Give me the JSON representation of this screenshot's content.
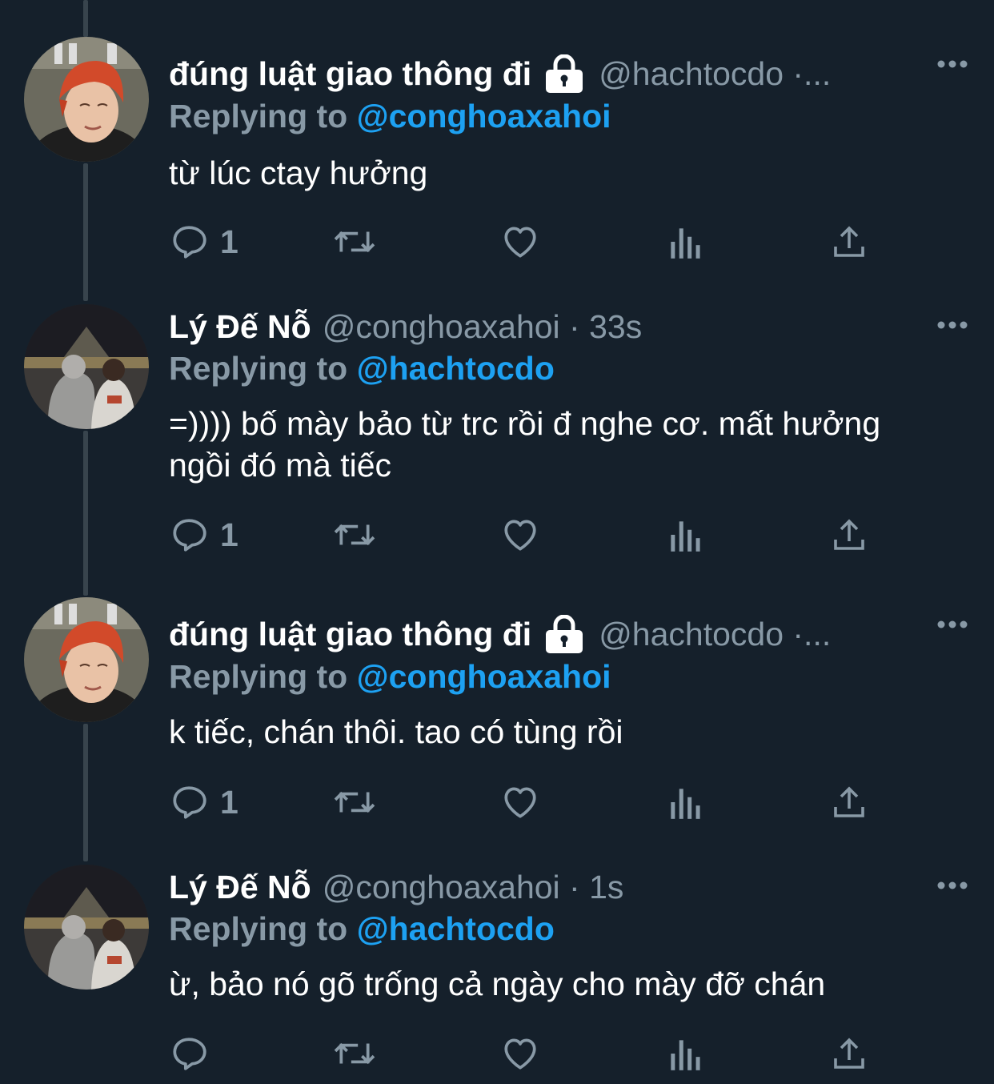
{
  "tweets": [
    {
      "author": "đúng luật giao thông đi",
      "locked": true,
      "handle_meta": "@hachtocdo ·...",
      "reply_prefix": "Replying to",
      "reply_to": "@conghoaxahoi",
      "text": "từ lúc ctay hưởng",
      "reply_count": "1",
      "avatar": "red-hair-person-avatar"
    },
    {
      "author": "Lý Đế Nỗ",
      "locked": false,
      "handle_meta": "@conghoaxahoi · 33s",
      "reply_prefix": "Replying to",
      "reply_to": "@hachtocdo",
      "text": "=)))) bố mày bảo từ trc rồi đ nghe cơ. mất hưởng ngồi đó mà tiếc",
      "reply_count": "1",
      "avatar": "two-people-louvre-avatar"
    },
    {
      "author": "đúng luật giao thông đi",
      "locked": true,
      "handle_meta": "@hachtocdo ·...",
      "reply_prefix": "Replying to",
      "reply_to": "@conghoaxahoi",
      "text": "k tiếc, chán thôi. tao có tùng rồi",
      "reply_count": "1",
      "avatar": "red-hair-person-avatar"
    },
    {
      "author": "Lý Đế Nỗ",
      "locked": false,
      "handle_meta": "@conghoaxahoi · 1s",
      "reply_prefix": "Replying to",
      "reply_to": "@hachtocdo",
      "text": "ừ, bảo nó gõ trống cả ngày cho mày đỡ chán",
      "reply_count": "",
      "avatar": "two-people-louvre-avatar"
    }
  ],
  "colors": {
    "background": "#15202b",
    "secondary_text": "#8899a6",
    "accent": "#1da1f2",
    "thread_line": "#38444d"
  },
  "icons": {
    "reply": "reply-icon",
    "retweet": "retweet-icon",
    "like": "heart-icon",
    "views": "views-icon",
    "share": "share-icon",
    "more": "more-icon",
    "lock": "lock-icon"
  }
}
